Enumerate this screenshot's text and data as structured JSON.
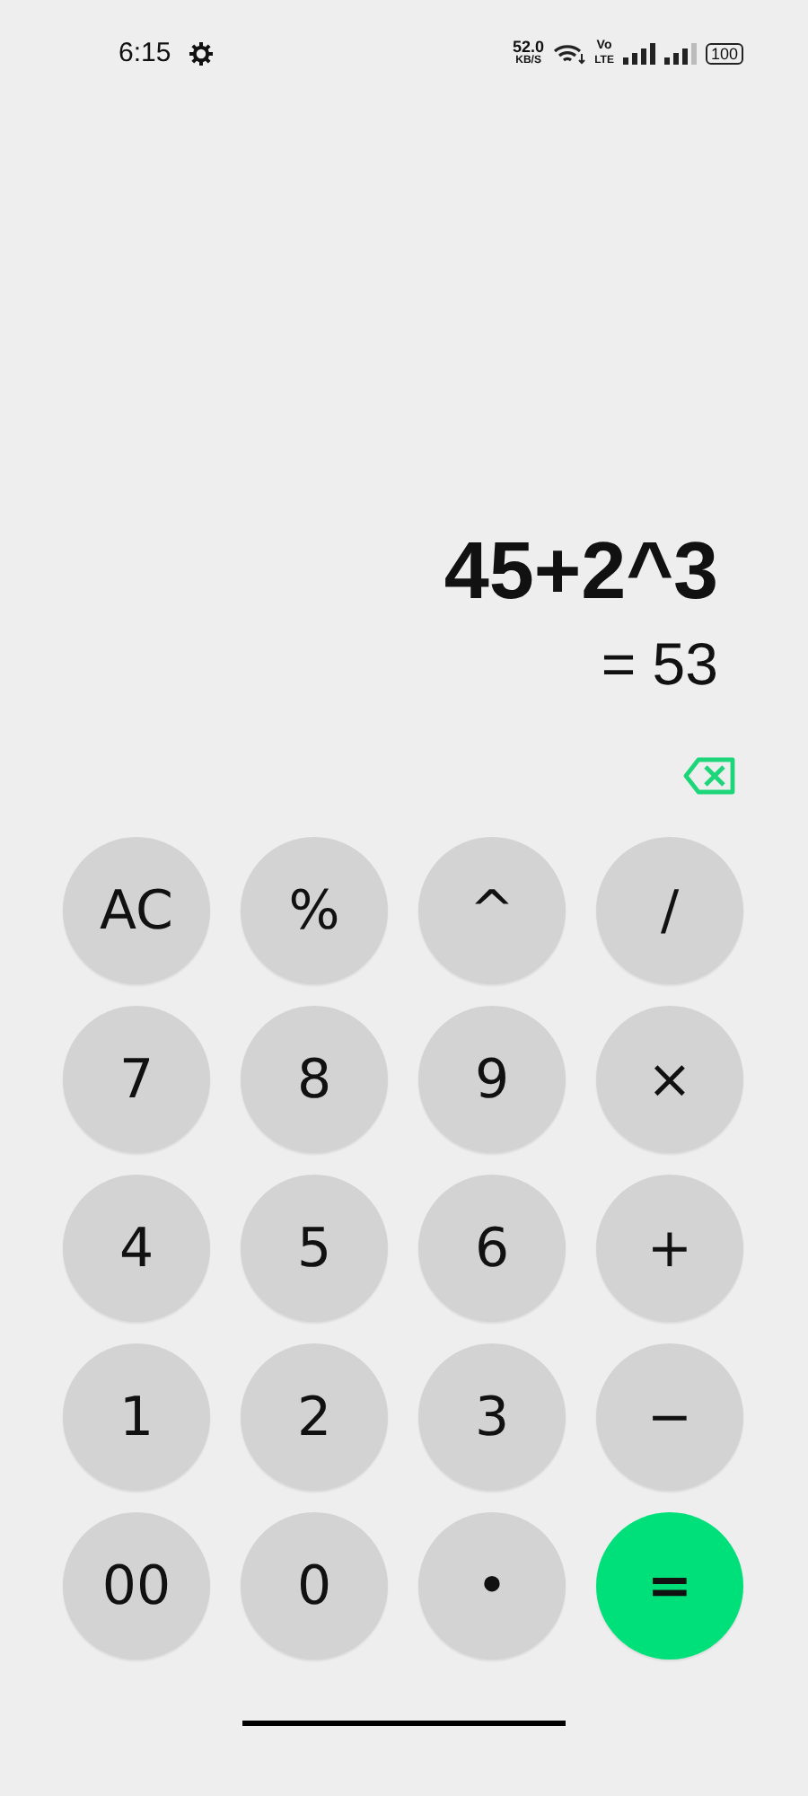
{
  "status_bar": {
    "time": "6:15",
    "net_speed": "52.0",
    "net_speed_unit": "KB/S",
    "volte_top": "Vo",
    "volte_bottom": "LTE",
    "battery": "100"
  },
  "display": {
    "expression": "45+2^3",
    "result": "= 53"
  },
  "keys": [
    {
      "label": "AC",
      "kind": "key"
    },
    {
      "label": "%",
      "kind": "key"
    },
    {
      "label": "^",
      "kind": "key"
    },
    {
      "label": "/",
      "kind": "key"
    },
    {
      "label": "7",
      "kind": "key"
    },
    {
      "label": "8",
      "kind": "key"
    },
    {
      "label": "9",
      "kind": "key"
    },
    {
      "label": "×",
      "kind": "key"
    },
    {
      "label": "4",
      "kind": "key"
    },
    {
      "label": "5",
      "kind": "key"
    },
    {
      "label": "6",
      "kind": "key"
    },
    {
      "label": "+",
      "kind": "key"
    },
    {
      "label": "1",
      "kind": "key"
    },
    {
      "label": "2",
      "kind": "key"
    },
    {
      "label": "3",
      "kind": "key"
    },
    {
      "label": "−",
      "kind": "key"
    },
    {
      "label": "00",
      "kind": "key"
    },
    {
      "label": "0",
      "kind": "key"
    },
    {
      "label": "•",
      "kind": "key"
    },
    {
      "label": "=",
      "kind": "equals"
    }
  ]
}
